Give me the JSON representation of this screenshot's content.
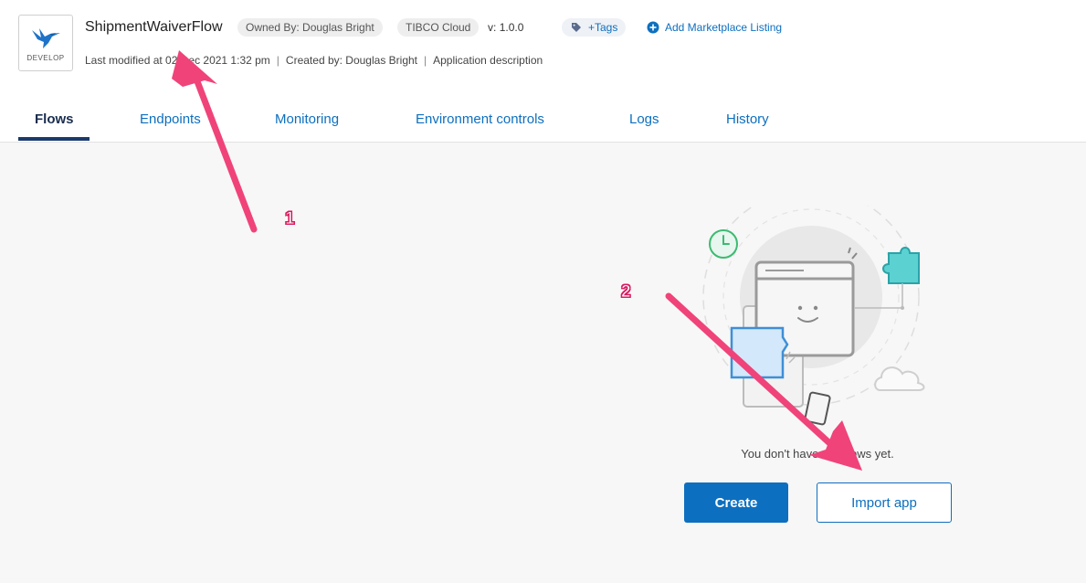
{
  "app": {
    "name": "ShipmentWaiverFlow",
    "stage": "DEVELOP",
    "owner": "Owned By: Douglas Bright",
    "platform": "TIBCO Cloud",
    "version_label": "v:",
    "version": "1.0.0",
    "tags_label": "+Tags",
    "marketplace_label": "Add Marketplace Listing",
    "last_modified": "Last modified at 02 Dec 2021 1:32 pm",
    "created_by": "Created by: Douglas Bright",
    "description": "Application description"
  },
  "tabs": [
    {
      "label": "Flows",
      "active": true
    },
    {
      "label": "Endpoints",
      "active": false
    },
    {
      "label": "Monitoring",
      "active": false
    },
    {
      "label": "Environment controls",
      "active": false
    },
    {
      "label": "Logs",
      "active": false
    },
    {
      "label": "History",
      "active": false
    }
  ],
  "empty_state": {
    "message": "You don't have any flows yet.",
    "create_label": "Create",
    "import_label": "Import app"
  },
  "annotations": {
    "marker_1": "1",
    "marker_2": "2",
    "color": "#f0437a"
  },
  "icons": {
    "app_logo": "hummingbird-icon",
    "tags": "tag-icon",
    "marketplace": "plus-circle-icon"
  }
}
